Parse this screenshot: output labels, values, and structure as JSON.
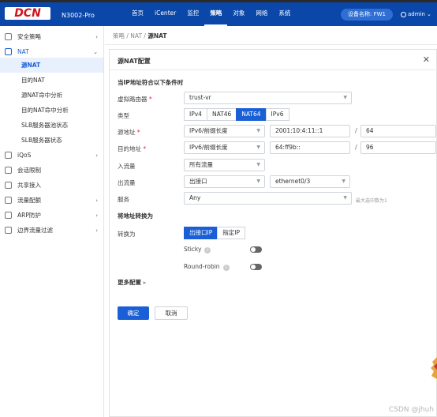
{
  "header": {
    "logo": "DCN",
    "model": "N3002-Pro",
    "nav": [
      "首页",
      "iCenter",
      "监控",
      "策略",
      "对象",
      "网络",
      "系统"
    ],
    "active_nav": "策略",
    "device_name": "设备名称: FW1",
    "user": "admin"
  },
  "sidebar": {
    "items": [
      {
        "label": "安全策略",
        "icon": "shield-list-icon"
      },
      {
        "label": "NAT",
        "icon": "nat-icon"
      },
      {
        "label": "iQoS",
        "icon": "bars-icon"
      },
      {
        "label": "会话限制",
        "icon": "session-icon"
      },
      {
        "label": "共享接入",
        "icon": "share-icon"
      },
      {
        "label": "流量配额",
        "icon": "quota-icon"
      },
      {
        "label": "ARP防护",
        "icon": "arp-shield-icon"
      },
      {
        "label": "边界流量过滤",
        "icon": "filter-icon"
      }
    ],
    "sub_items": [
      "源NAT",
      "目的NAT",
      "源NAT命中分析",
      "目的NAT命中分析",
      "SLB服务器池状态",
      "SLB服务器状态"
    ],
    "active_sub": "源NAT"
  },
  "breadcrumb": {
    "path": "策略 / NAT / ",
    "current": "源NAT"
  },
  "dialog": {
    "title": "源NAT配置",
    "section_match": "当IP地址符合以下条件时",
    "section_translate": "将地址转换为",
    "more": "更多配置",
    "labels": {
      "vrouter": "虚拟路由器",
      "type": "类型",
      "src_addr": "源地址",
      "dst_addr": "目的地址",
      "ingress": "入流量",
      "egress": "出流量",
      "service": "服务",
      "translate_to": "转换为",
      "sticky": "Sticky",
      "round_robin": "Round-robin"
    },
    "vrouter_value": "trust-vr",
    "type_options": [
      "IPv4",
      "NAT46",
      "NAT64",
      "IPv6"
    ],
    "type_selected": "NAT64",
    "src": {
      "kind": "IPv6/前缀长度",
      "addr": "2001:10:4:11::1",
      "prefix": "64"
    },
    "dst": {
      "kind": "IPv6/前缀长度",
      "addr": "64:ff9b::",
      "prefix": "96"
    },
    "ingress_value": "所有流量",
    "egress_kind": "出接口",
    "egress_iface": "ethernet0/3",
    "service_value": "Any",
    "service_hint": "最大选中数为1",
    "translate_options": [
      "出接口IP",
      "指定IP"
    ],
    "translate_selected": "出接口IP",
    "ok": "确定",
    "cancel": "取消"
  },
  "watermark": "CSDN @jhuh"
}
